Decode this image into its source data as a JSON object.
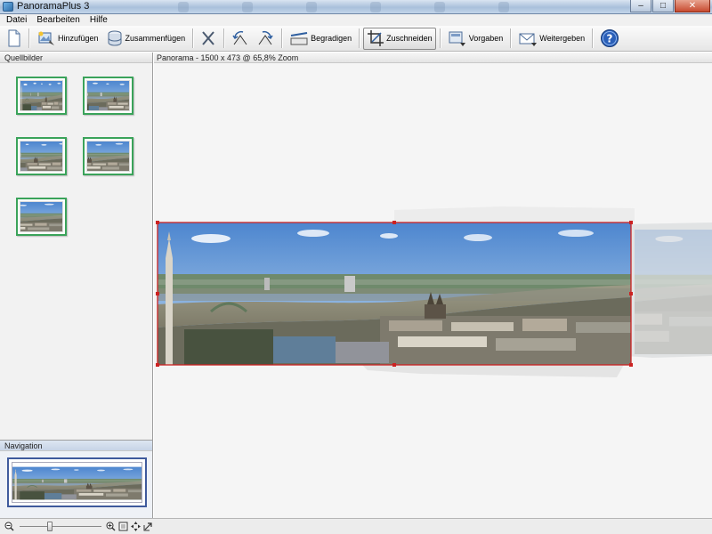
{
  "window": {
    "title": "PanoramaPlus 3",
    "controls": [
      "minimize",
      "maximize",
      "close"
    ]
  },
  "menu": {
    "items": [
      "Datei",
      "Bearbeiten",
      "Hilfe"
    ]
  },
  "toolbar": {
    "buttons": [
      {
        "id": "new",
        "icon": "new-document-icon",
        "label": ""
      },
      {
        "id": "add",
        "icon": "add-images-icon",
        "label": "Hinzufügen"
      },
      {
        "id": "stitch",
        "icon": "stitch-icon",
        "label": "Zusammenfügen"
      },
      {
        "id": "remove",
        "icon": "remove-x-icon",
        "label": ""
      },
      {
        "id": "rotate-left",
        "icon": "rotate-left-icon",
        "label": ""
      },
      {
        "id": "rotate-right",
        "icon": "rotate-right-icon",
        "label": ""
      },
      {
        "id": "straighten",
        "icon": "straighten-icon",
        "label": "Begradigen"
      },
      {
        "id": "crop",
        "icon": "crop-icon",
        "label": "Zuschneiden",
        "active": true
      },
      {
        "id": "presets",
        "icon": "presets-icon",
        "label": "Vorgaben"
      },
      {
        "id": "share",
        "icon": "share-envelope-icon",
        "label": "Weitergeben"
      },
      {
        "id": "help",
        "icon": "help-icon",
        "label": ""
      }
    ]
  },
  "source_panel": {
    "title": "Quellbilder",
    "thumbnail_count": 5,
    "selected_border_color": "#3aa35a"
  },
  "navigation_panel": {
    "title": "Navigation",
    "view_border_color": "#3f5a9c"
  },
  "main": {
    "header": "Panorama - 1500 x 473 @ 65,8% Zoom",
    "crop_frame_color": "#cc2222"
  },
  "statusbar": {
    "zoom_slider_level": 0.36,
    "icons": [
      "zoom-out-icon",
      "zoom-in-icon",
      "fit-to-window-icon",
      "pan-icon",
      "fullscreen-icon"
    ]
  }
}
